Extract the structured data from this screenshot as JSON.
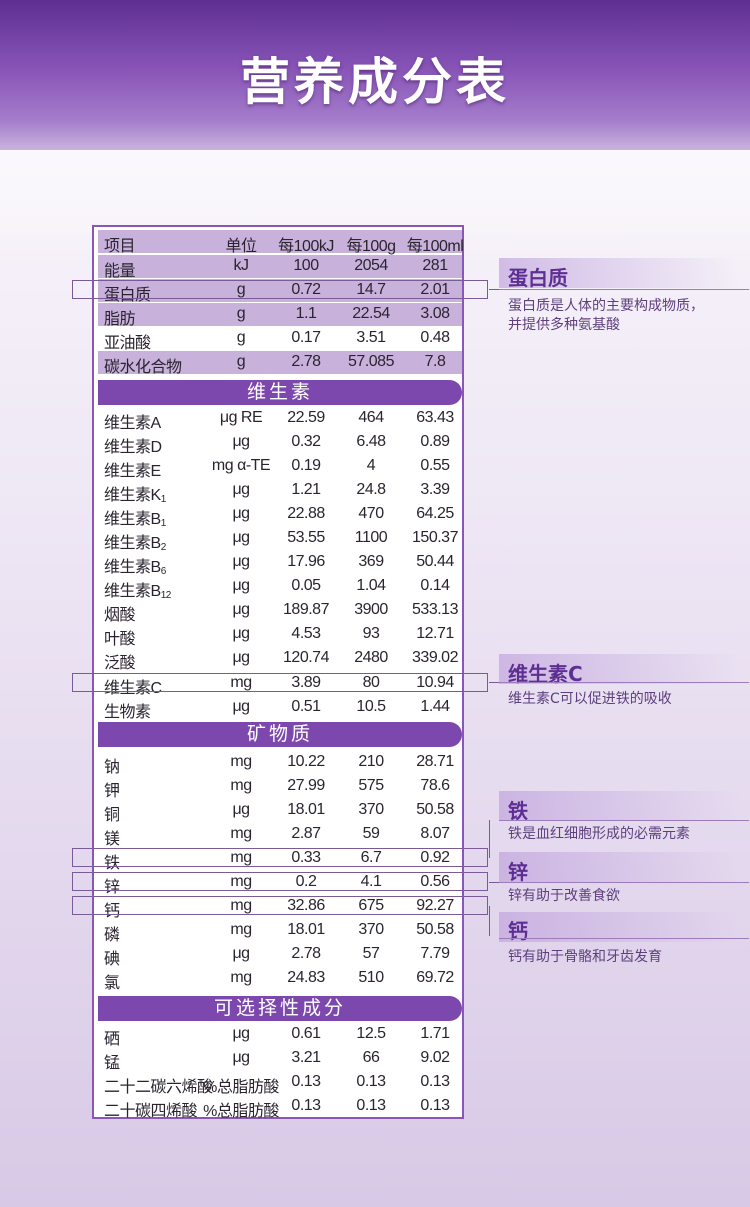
{
  "title": "营养成分表",
  "table": {
    "header": [
      "项目",
      "单位",
      "每100kJ",
      "每100g",
      "每100ml"
    ],
    "basic": [
      [
        "能量",
        "kJ",
        "100",
        "2054",
        "281"
      ],
      [
        "蛋白质",
        "g",
        "0.72",
        "14.7",
        "2.01"
      ],
      [
        "脂肪",
        "g",
        "1.1",
        "22.54",
        "3.08"
      ],
      [
        "亚油酸",
        "g",
        "0.17",
        "3.51",
        "0.48"
      ],
      [
        "碳水化合物",
        "g",
        "2.78",
        "57.085",
        "7.8"
      ]
    ],
    "vitamins_title": "维生素",
    "vitamins": [
      [
        "维生素A",
        "μg RE",
        "22.59",
        "464",
        "63.43"
      ],
      [
        "维生素D",
        "μg",
        "0.32",
        "6.48",
        "0.89"
      ],
      [
        "维生素E",
        "mg α-TE",
        "0.19",
        "4",
        "0.55"
      ],
      [
        "维生素K",
        "1",
        "μg",
        "1.21",
        "24.8",
        "3.39"
      ],
      [
        "维生素B",
        "1",
        "μg",
        "22.88",
        "470",
        "64.25"
      ],
      [
        "维生素B",
        "2",
        "μg",
        "53.55",
        "1100",
        "150.37"
      ],
      [
        "维生素B",
        "6",
        "μg",
        "17.96",
        "369",
        "50.44"
      ],
      [
        "维生素B",
        "12",
        "μg",
        "0.05",
        "1.04",
        "0.14"
      ],
      [
        "烟酸",
        "μg",
        "189.87",
        "3900",
        "533.13"
      ],
      [
        "叶酸",
        "μg",
        "4.53",
        "93",
        "12.71"
      ],
      [
        "泛酸",
        "μg",
        "120.74",
        "2480",
        "339.02"
      ],
      [
        "维生素C",
        "mg",
        "3.89",
        "80",
        "10.94"
      ],
      [
        "生物素",
        "μg",
        "0.51",
        "10.5",
        "1.44"
      ]
    ],
    "minerals_title": "矿物质",
    "minerals": [
      [
        "钠",
        "mg",
        "10.22",
        "210",
        "28.71"
      ],
      [
        "钾",
        "mg",
        "27.99",
        "575",
        "78.6"
      ],
      [
        "铜",
        "μg",
        "18.01",
        "370",
        "50.58"
      ],
      [
        "镁",
        "mg",
        "2.87",
        "59",
        "8.07"
      ],
      [
        "铁",
        "mg",
        "0.33",
        "6.7",
        "0.92"
      ],
      [
        "锌",
        "mg",
        "0.2",
        "4.1",
        "0.56"
      ],
      [
        "钙",
        "mg",
        "32.86",
        "675",
        "92.27"
      ],
      [
        "磷",
        "mg",
        "18.01",
        "370",
        "50.58"
      ],
      [
        "碘",
        "μg",
        "2.78",
        "57",
        "7.79"
      ],
      [
        "氯",
        "mg",
        "24.83",
        "510",
        "69.72"
      ]
    ],
    "optional_title": "可选择性成分",
    "optional": [
      [
        "硒",
        "μg",
        "0.61",
        "12.5",
        "1.71"
      ],
      [
        "锰",
        "μg",
        "3.21",
        "66",
        "9.02"
      ],
      [
        "二十二碳六烯酸",
        "%总脂肪酸",
        "0.13",
        "0.13",
        "0.13"
      ],
      [
        "二十碳四烯酸",
        "%总脂肪酸",
        "0.13",
        "0.13",
        "0.13"
      ]
    ]
  },
  "notes": [
    {
      "title": "蛋白质",
      "text": "蛋白质是人体的主要构成物质，",
      "text2": "并提供多种氨基酸"
    },
    {
      "title": "维生素C",
      "text": "维生素C可以促进铁的吸收"
    },
    {
      "title": "铁",
      "text": "铁是血红细胞形成的必需元素"
    },
    {
      "title": "锌",
      "text": "锌有助于改善食欲"
    },
    {
      "title": "钙",
      "text": "钙有助于骨骼和牙齿发育"
    }
  ],
  "colors": {
    "accent": "#7d48ad",
    "shade": "#c8b2dc",
    "header": "#6a3aa0"
  }
}
